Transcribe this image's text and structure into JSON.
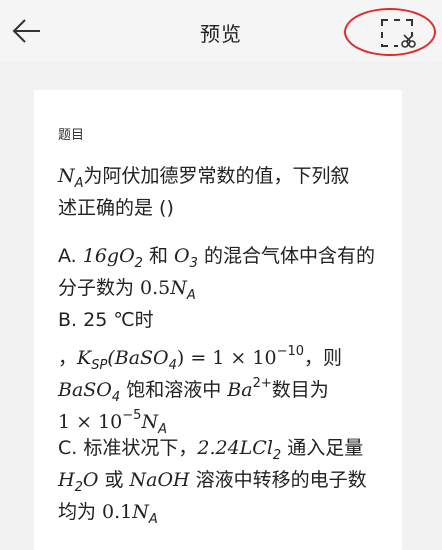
{
  "header": {
    "title": "预览",
    "back_icon": "arrow-left-icon",
    "crop_icon": "crop-scissors-icon",
    "highlight_color": "#e02b2b"
  },
  "question": {
    "section_label": "题目",
    "stem": {
      "na_base": "N",
      "na_sub": "A",
      "text1": "为阿伏加德罗常数的值，下列叙",
      "text2": "述正确的是 ()"
    },
    "option_a": {
      "prefix": "A. ",
      "mass": "16g",
      "o2_base": "O",
      "o2_sub": "2",
      "and": " 和 ",
      "o3_base": "O",
      "o3_sub": "3",
      "text_mix": " 的混合气体中含有的",
      "text_line2": "分子数为 ",
      "val": "0.5",
      "na_base": "N",
      "na_sub": "A"
    },
    "option_b": {
      "prefix": "B. ",
      "temp": "25 ℃时",
      "comma": "，",
      "ksp_base": "K",
      "ksp_sub": "SP",
      "ksp_arg": "(BaSO",
      "ksp_arg_sub": "4",
      "ksp_eq": ") = 1 × 10",
      "ksp_exp": "−10",
      "then": "，则",
      "baso4_base": "BaSO",
      "baso4_sub": "4",
      "sat": " 饱和溶液中 ",
      "ba": "Ba",
      "ba_sup": "2+",
      "count": "数目为",
      "val_pre": "1 × 10",
      "val_exp": "−5",
      "na_base": "N",
      "na_sub": "A"
    },
    "option_c": {
      "prefix": "C. ",
      "std": "标准状况下，",
      "amount": "2.24L",
      "cl2_base": "Cl",
      "cl2_sub": "2",
      "pass": " 通入足量",
      "h2o_h": "H",
      "h2o_sub": "2",
      "h2o_o": "O",
      "or": " 或 ",
      "naoh": "NaOH",
      "transfer": " 溶液中转移的电子数",
      "avg": "均为 ",
      "val": "0.1",
      "na_base": "N",
      "na_sub": "A"
    }
  }
}
